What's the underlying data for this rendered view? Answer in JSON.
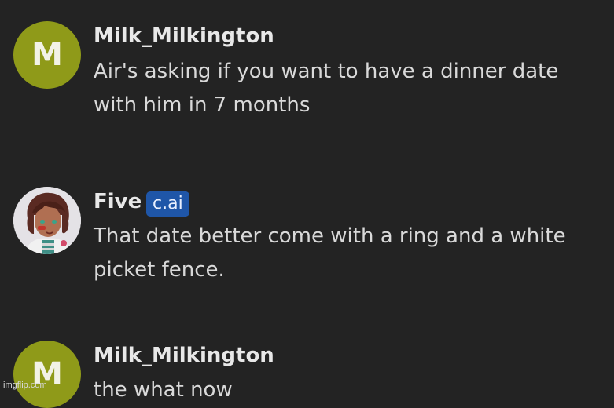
{
  "messages": [
    {
      "avatar_letter": "M",
      "username": "Milk_Milkington",
      "text": "Air's asking if you want to have a dinner date with him in 7 months"
    },
    {
      "username": "Five",
      "badge": "c.ai",
      "text": "That date better come with a ring and a white picket fence."
    },
    {
      "avatar_letter": "M",
      "username": "Milk_Milkington",
      "text": "the what now"
    }
  ],
  "watermark": "imgflip.com",
  "colors": {
    "background": "#232323",
    "avatar_letter_bg": "#8f9a19",
    "badge_bg": "#1f56a8"
  }
}
